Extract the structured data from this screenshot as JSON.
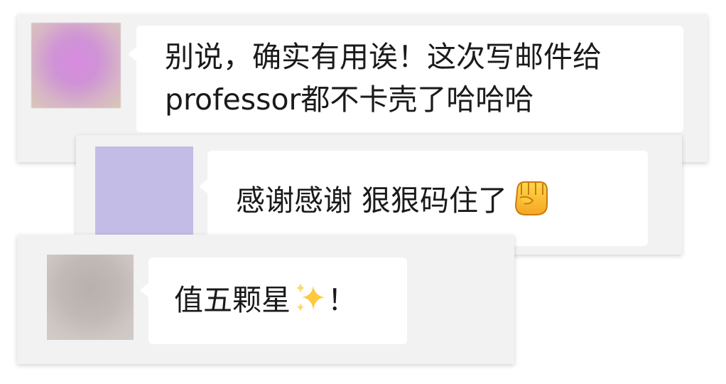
{
  "comments": [
    {
      "text_line1": "别说，确实有用诶！这次写邮件给",
      "text_line2": "professor都不卡壳了哈哈哈"
    },
    {
      "text": "感谢感谢 狠狠码住了",
      "emoji": "fist-icon"
    },
    {
      "text": "值五颗星",
      "emoji": "sparkle-icon",
      "suffix": "！"
    }
  ],
  "colors": {
    "card_background": "#f2f2f2",
    "bubble_background": "#ffffff",
    "text": "#1a1a1a",
    "avatar_2": "#c3bce6"
  }
}
